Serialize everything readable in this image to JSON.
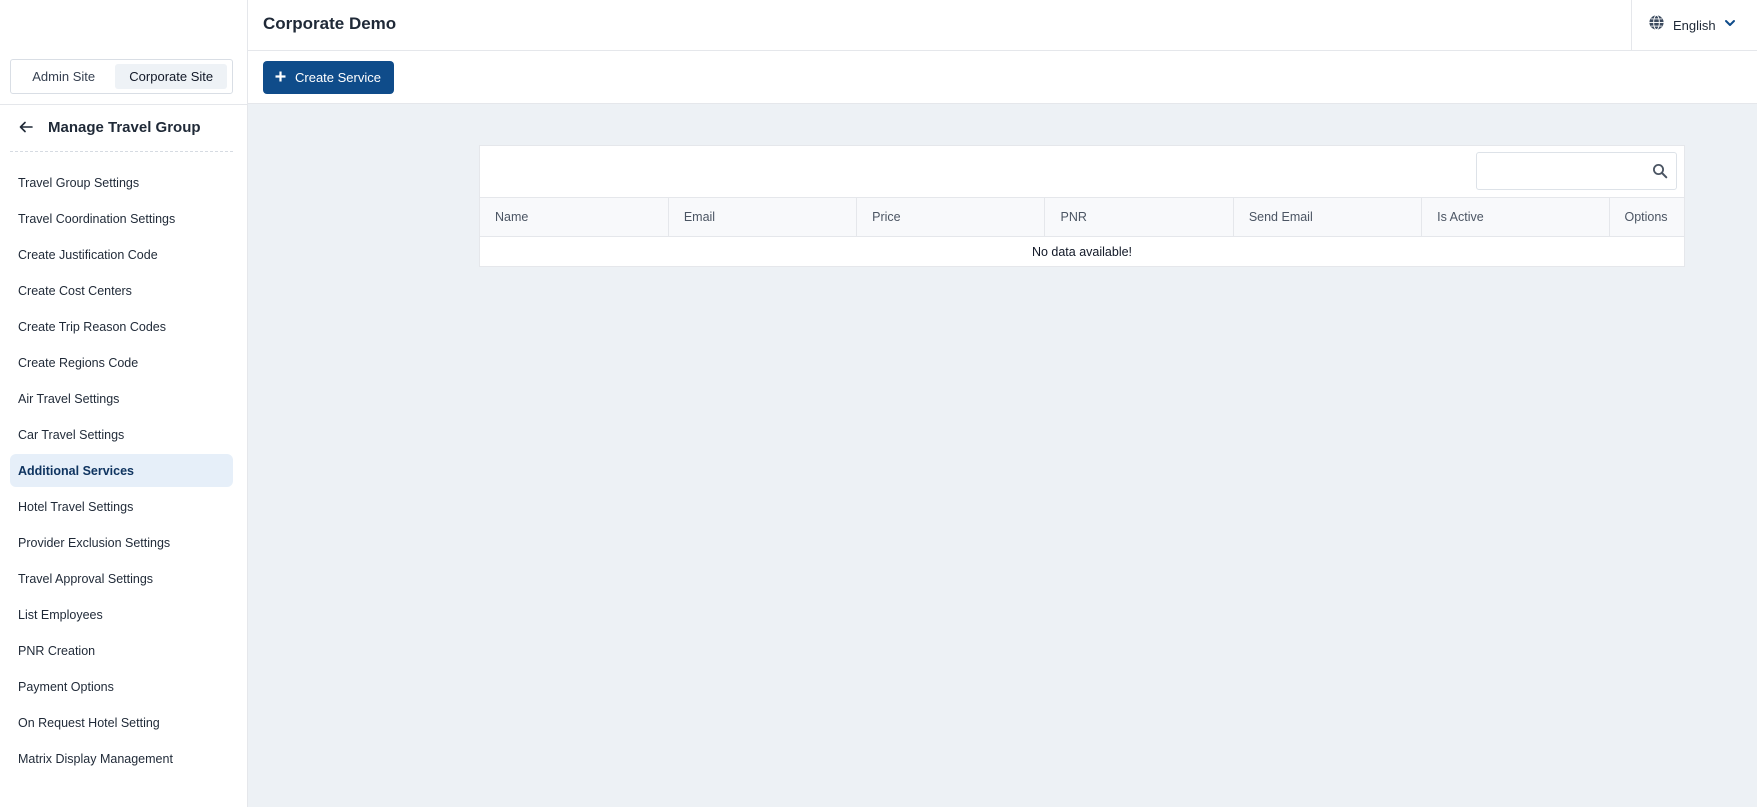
{
  "sidebar": {
    "site_switch": {
      "admin_label": "Admin Site",
      "corporate_label": "Corporate Site"
    },
    "group_title": "Manage Travel Group",
    "items": [
      {
        "label": "Travel Group Settings"
      },
      {
        "label": "Travel Coordination Settings"
      },
      {
        "label": "Create Justification Code"
      },
      {
        "label": "Create Cost Centers"
      },
      {
        "label": "Create Trip Reason Codes"
      },
      {
        "label": "Create Regions Code"
      },
      {
        "label": "Air Travel Settings"
      },
      {
        "label": "Car Travel Settings"
      },
      {
        "label": "Additional Services",
        "active": true
      },
      {
        "label": "Hotel Travel Settings"
      },
      {
        "label": "Provider Exclusion Settings"
      },
      {
        "label": "Travel Approval Settings"
      },
      {
        "label": "List Employees"
      },
      {
        "label": "PNR Creation"
      },
      {
        "label": "Payment Options"
      },
      {
        "label": "On Request Hotel Setting"
      },
      {
        "label": "Matrix Display Management"
      }
    ]
  },
  "header": {
    "title": "Corporate Demo",
    "language": "English"
  },
  "toolbar": {
    "create_label": "Create Service"
  },
  "table": {
    "search_placeholder": "",
    "columns": [
      "Name",
      "Email",
      "Price",
      "PNR",
      "Send Email",
      "Is Active",
      "Options"
    ],
    "empty_message": "No data available!"
  },
  "colors": {
    "primary": "#0f4c8a",
    "active_item_bg": "#e6eff9",
    "content_bg": "#edf1f5"
  },
  "icons": [
    "back-arrow-icon",
    "globe-icon",
    "chevron-down-icon",
    "plus-icon",
    "search-icon"
  ]
}
